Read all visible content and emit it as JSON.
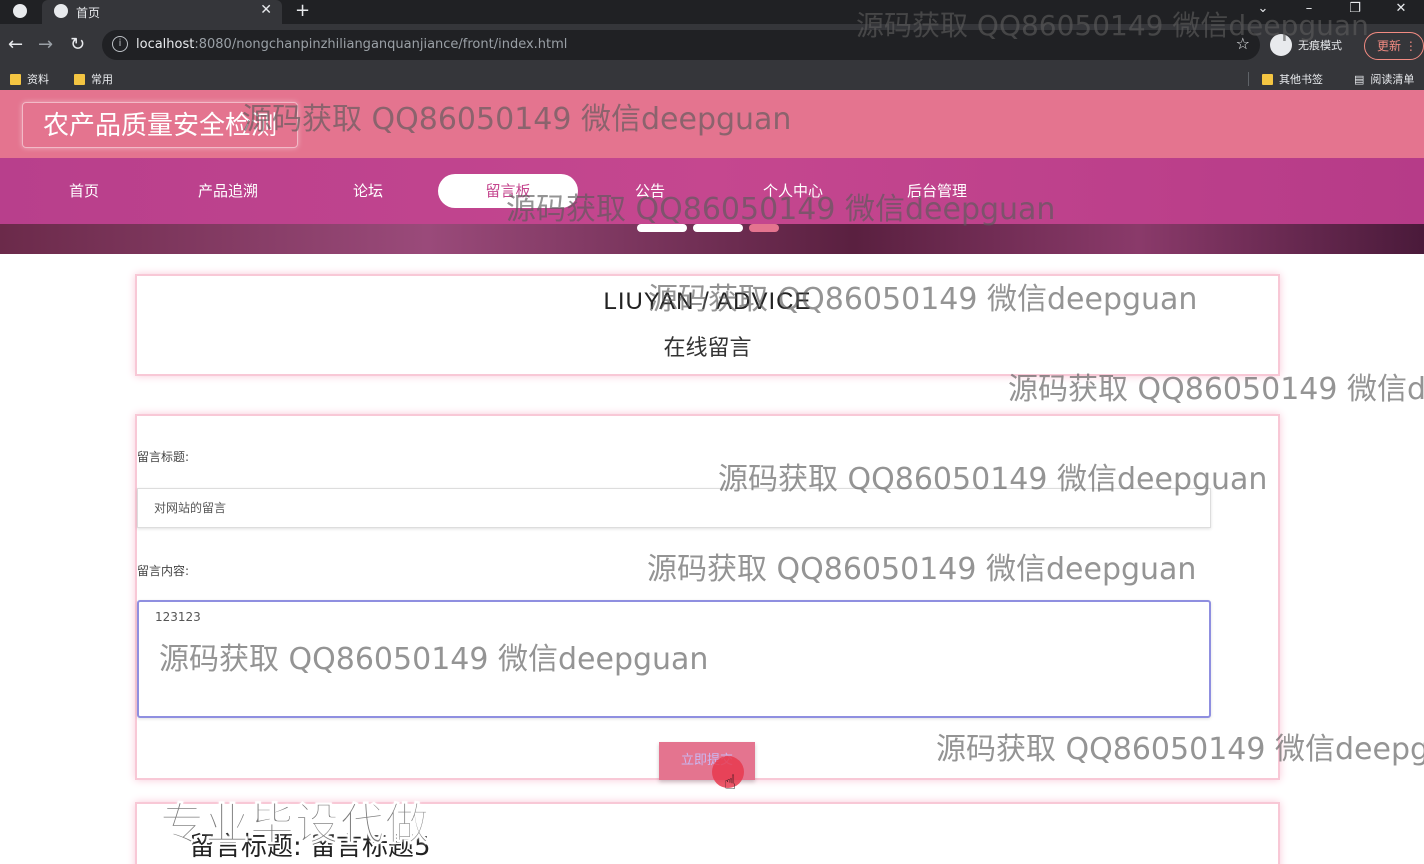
{
  "browser": {
    "tab_title": "首页",
    "new_tab_symbol": "+",
    "url_host": "localhost",
    "url_rest": ":8080/nongchanpinzhilianganquanjiance/front/index.html",
    "incognito_label": "无痕模式",
    "update_label": "更新",
    "bookmarks": [
      "资料",
      "常用"
    ],
    "bookmarks_right": [
      "其他书签",
      "阅读清单"
    ],
    "window_controls": [
      "⌄",
      "–",
      "❐",
      "✕"
    ]
  },
  "site": {
    "title": "农产品质量安全检测",
    "nav": [
      "首页",
      "产品追溯",
      "论坛",
      "留言板",
      "公告",
      "个人中心",
      "后台管理"
    ],
    "active_nav": "留言板"
  },
  "section": {
    "title_en": "LIUYAN / ADVICE",
    "title_cn": "在线留言"
  },
  "form": {
    "title_label": "留言标题:",
    "title_value": "对网站的留言",
    "content_label": "留言内容:",
    "content_value": "123123",
    "submit_label": "立即提交"
  },
  "messages": [
    {
      "title_label": "留言标题:",
      "title_value": "留言标题5"
    }
  ],
  "overlay": {
    "watermark": "源码获取 QQ86050149 微信deepguan",
    "watermark_clipped_1": "源码获取 QQ86050149 微信de",
    "watermark_clipped_2": "源码获取 QQ86050149 微信deepgu",
    "promo": "专业毕设代做"
  },
  "colors": {
    "header_pink": "#e4748f",
    "nav_magenta": "#c5478f",
    "card_border": "#f8c8d6"
  }
}
